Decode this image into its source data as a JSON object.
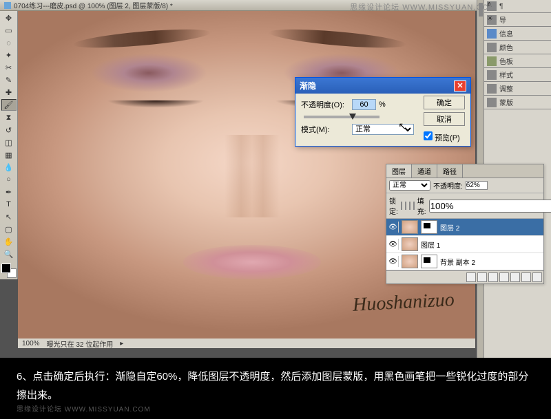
{
  "title_bar": "0704练习---磨皮.psd @ 100% (图层 2, 图层蒙版/8) *",
  "watermark_top": "思缘设计论坛  WWW.MISSYUAN.COM",
  "signature": "Huoshanizuo",
  "status": {
    "zoom": "100%",
    "info": "曝光只在 32 位起作用"
  },
  "dialog": {
    "title": "渐隐",
    "opacity_label": "不透明度(O):",
    "opacity_value": "60",
    "percent": "%",
    "mode_label": "模式(M):",
    "mode_value": "正常",
    "ok": "确定",
    "cancel": "取消",
    "preview": "预览(P)"
  },
  "right_panel": {
    "items": [
      "导",
      "信息",
      "颜色",
      "色板",
      "样式",
      "调整",
      "蒙版"
    ]
  },
  "layers": {
    "tabs": [
      "图层",
      "通道",
      "路径"
    ],
    "blend": "正常",
    "opacity_label": "不透明度:",
    "opacity_value": "62%",
    "lock_label": "锁定:",
    "fill_label": "填充:",
    "fill_value": "100%",
    "rows": [
      {
        "name": "图层 2",
        "selected": true,
        "mask": true
      },
      {
        "name": "图层 1",
        "selected": false,
        "mask": false
      },
      {
        "name": "背景 副本 2",
        "selected": false,
        "mask": true
      }
    ],
    "side_tabs": [
      "图层",
      "通道",
      "路径"
    ]
  },
  "caption": "6、点击确定后执行：渐隐自定60%，降低图层不透明度，然后添加图层蒙版，用黑色画笔把一些锐化过度的部分擦出来。",
  "watermark_bottom": "思缘设计论坛  WWW.MISSYUAN.COM"
}
